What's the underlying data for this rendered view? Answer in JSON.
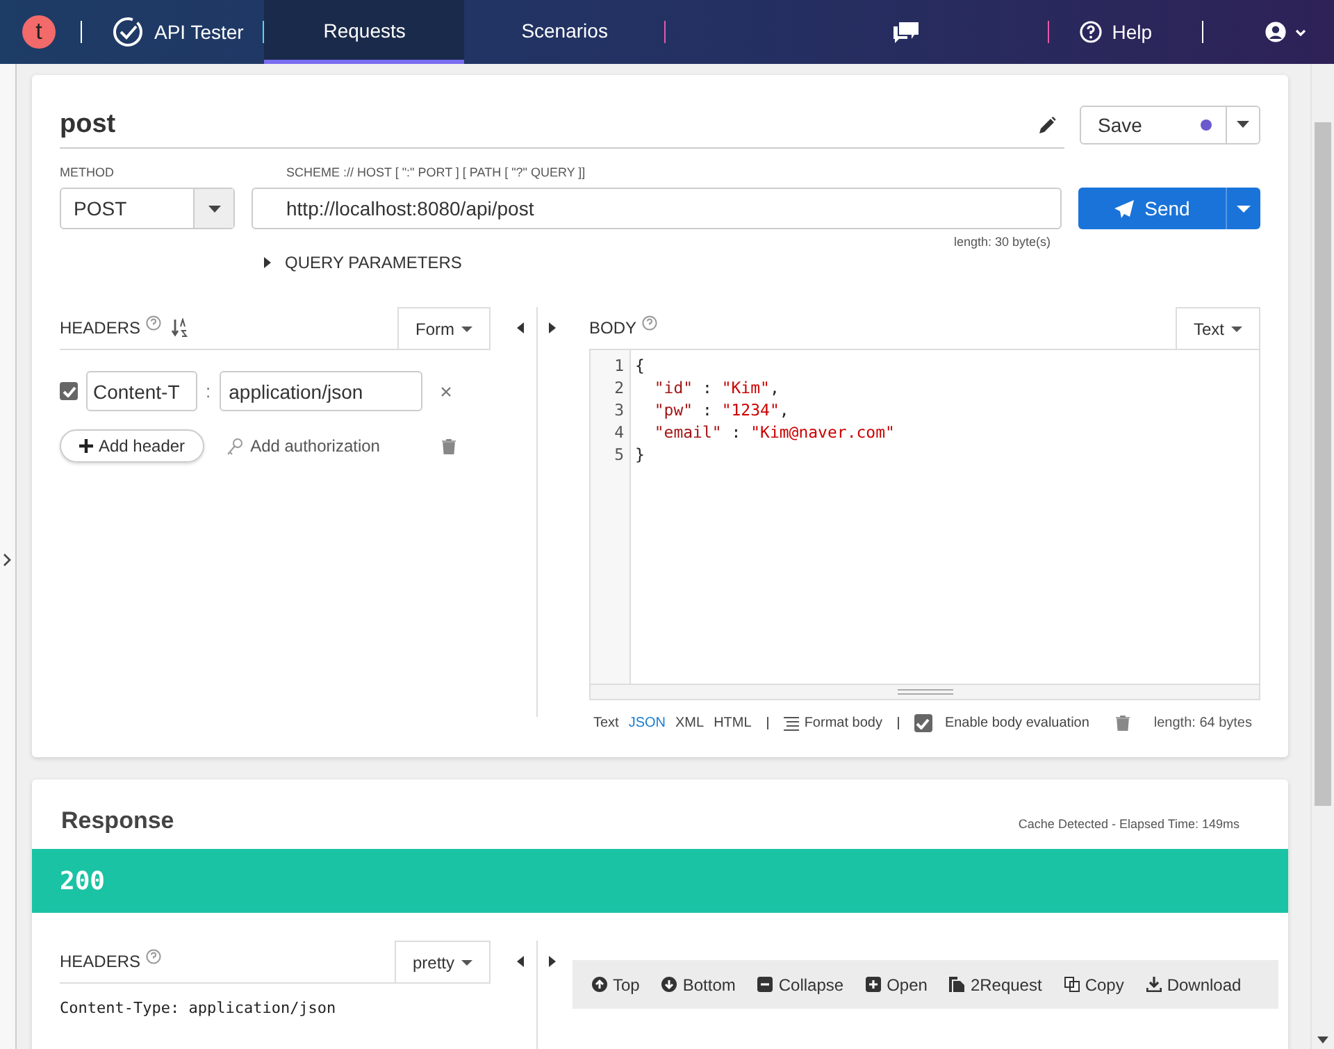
{
  "topbar": {
    "logo": "t",
    "app_name": "API Tester",
    "tabs": [
      {
        "label": "Requests",
        "selected": true
      },
      {
        "label": "Scenarios",
        "selected": false
      }
    ],
    "help": "Help"
  },
  "request": {
    "name": "post",
    "save": "Save",
    "method_label": "METHOD",
    "method": "POST",
    "url_label": "SCHEME :// HOST [ \":\" PORT ] [ PATH [ \"?\" QUERY ]]",
    "url": "http://localhost:8080/api/post",
    "send": "Send",
    "url_length": "length: 30 byte(s)",
    "query_parameters": "QUERY PARAMETERS",
    "headers": {
      "title": "HEADERS",
      "mode": "Form",
      "rows": [
        {
          "checked": true,
          "name": "Content-T",
          "sep": ":",
          "value": "application/json"
        }
      ],
      "add_header": "Add header",
      "add_authorization": "Add authorization"
    },
    "body": {
      "title": "BODY",
      "mode": "Text",
      "lines": [
        {
          "number": "1",
          "text": "{"
        },
        {
          "number": "2",
          "key": "\"id\"",
          "sep": " : ",
          "value": "\"Kim\"",
          "end": ","
        },
        {
          "number": "3",
          "key": "\"pw\"",
          "sep": " : ",
          "value": "\"1234\"",
          "end": ","
        },
        {
          "number": "4",
          "key": "\"email\"",
          "sep": " : ",
          "value": "\"Kim@naver.com\""
        },
        {
          "number": "5",
          "text": "}"
        }
      ],
      "formats": [
        {
          "label": "Text",
          "selected": false
        },
        {
          "label": "JSON",
          "selected": true
        },
        {
          "label": "XML",
          "selected": false
        },
        {
          "label": "HTML",
          "selected": false
        }
      ],
      "format_body": "Format body",
      "evaluation": {
        "label": "Enable body evaluation",
        "checked": true
      },
      "length": "length: 64 bytes"
    }
  },
  "response": {
    "title": "Response",
    "timing": "Cache Detected - Elapsed Time: 149ms",
    "status": "200",
    "headers": {
      "title": "HEADERS",
      "mode": "pretty",
      "lines": [
        "Content-Type:  application/json"
      ]
    },
    "toolbar": [
      "Top",
      "Bottom",
      "Collapse",
      "Open",
      "2Request",
      "Copy",
      "Download"
    ]
  }
}
